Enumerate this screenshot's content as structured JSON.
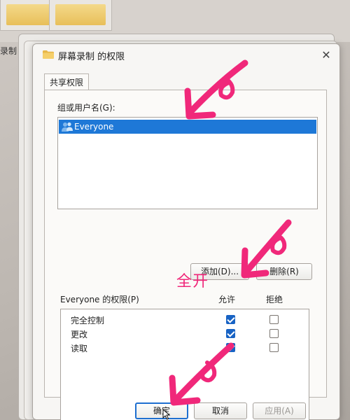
{
  "background": {
    "left_label": "录制"
  },
  "dialog": {
    "title": "屏幕录制 的权限",
    "close_symbol": "✕",
    "tab_label": "共享权限",
    "group_label": "组或用户名(G):",
    "users": [
      {
        "name": "Everyone",
        "selected": true
      }
    ],
    "add_button": "添加(D)...",
    "remove_button": "删除(R)",
    "permissions_label": "Everyone 的权限(P)",
    "col_allow": "允许",
    "col_deny": "拒绝",
    "permissions": [
      {
        "name": "完全控制",
        "allow": true,
        "deny": false
      },
      {
        "name": "更改",
        "allow": true,
        "deny": false
      },
      {
        "name": "读取",
        "allow": true,
        "deny": false
      }
    ],
    "ok_button": "确定",
    "cancel_button": "取消",
    "apply_button": "应用(A)"
  },
  "annotations": {
    "text": "全开",
    "color": "#f0287a"
  },
  "colors": {
    "selection": "#1e78d7",
    "checkbox_checked": "#1863c4"
  }
}
